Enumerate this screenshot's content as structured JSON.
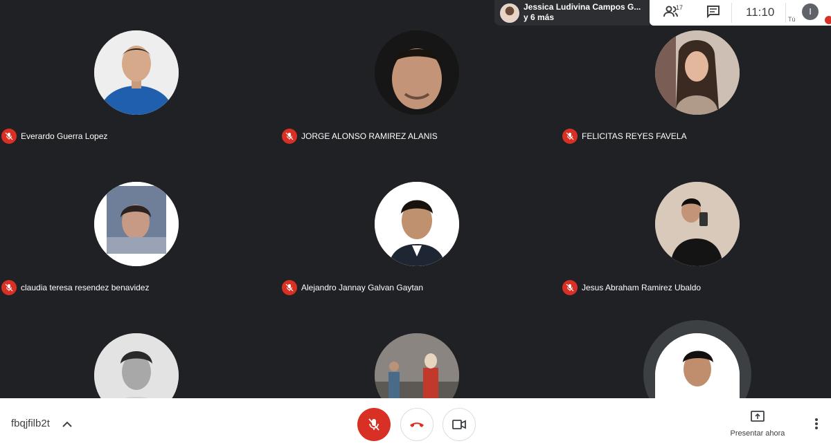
{
  "presenter": {
    "name": "Jessica Ludivina Campos G...",
    "more": "y 6 más"
  },
  "topbar": {
    "people_count": "17",
    "clock": "11:10",
    "you_label": "Tú",
    "avatar_initial": "I"
  },
  "participants": [
    {
      "name": "Everardo Guerra Lopez"
    },
    {
      "name": "JORGE ALONSO RAMIREZ ALANIS"
    },
    {
      "name": "FELICITAS REYES FAVELA"
    },
    {
      "name": "claudia teresa resendez benavidez"
    },
    {
      "name": "Alejandro Jannay Galvan Gaytan"
    },
    {
      "name": "Jesus Abraham Ramirez Ubaldo"
    }
  ],
  "bottombar": {
    "meeting_code": "fbqjfilb2t",
    "present_label": "Presentar ahora"
  },
  "colors": {
    "mute_red": "#d93025",
    "bg": "#202124"
  }
}
